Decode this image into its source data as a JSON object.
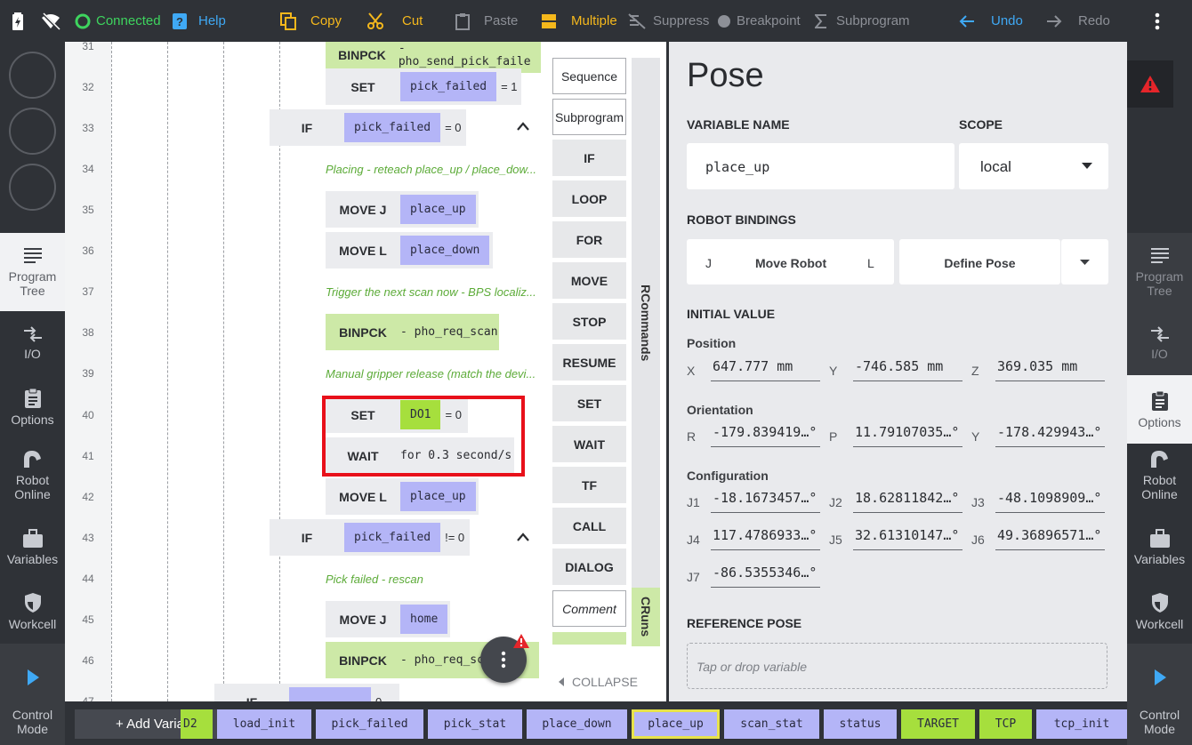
{
  "toolbar": {
    "connected": "Connected",
    "help": "Help",
    "copy": "Copy",
    "cut": "Cut",
    "paste": "Paste",
    "multiple": "Multiple",
    "suppress": "Suppress",
    "breakpoint": "Breakpoint",
    "subprogram": "Subprogram",
    "undo": "Undo",
    "redo": "Redo"
  },
  "left_nav": {
    "program_tree": "Program\nTree",
    "io": "I/O",
    "options": "Options",
    "robot_online": "Robot\nOnline",
    "variables": "Variables",
    "workcell": "Workcell",
    "control_mode": "Control\nMode"
  },
  "right_nav": {
    "program_tree": "Program\nTree",
    "io": "I/O",
    "options": "Options",
    "robot_online": "Robot\nOnline",
    "variables": "Variables",
    "workcell": "Workcell",
    "control_mode": "Control\nMode"
  },
  "program": {
    "line_numbers": [
      "31",
      "32",
      "33",
      "34",
      "35",
      "36",
      "37",
      "38",
      "39",
      "40",
      "41",
      "42",
      "43",
      "44",
      "45",
      "46",
      "47"
    ],
    "line31": {
      "kw": "BINPCK",
      "text": "- pho_send_pick_faile"
    },
    "line32": {
      "kw": "SET",
      "var": "pick_failed",
      "op": "= 1"
    },
    "line33": {
      "kw": "IF",
      "var": "pick_failed",
      "op": "= 0"
    },
    "line34": {
      "comment": "Placing - reteach place_up / place_dow..."
    },
    "line35": {
      "kw": "MOVE J",
      "var": "place_up"
    },
    "line36": {
      "kw": "MOVE L",
      "var": "place_down"
    },
    "line37": {
      "comment": "Trigger the next scan now - BPS localiz..."
    },
    "line38": {
      "kw": "BINPCK",
      "text": "- pho_req_scan"
    },
    "line39": {
      "comment": "Manual gripper release (match the devi..."
    },
    "line40": {
      "kw": "SET",
      "var": "DO1",
      "op": "= 0"
    },
    "line41": {
      "kw": "WAIT",
      "text": "for 0.3 second/s"
    },
    "line42": {
      "kw": "MOVE L",
      "var": "place_up"
    },
    "line43": {
      "kw": "IF",
      "var": "pick_failed",
      "op": "!= 0"
    },
    "line44": {
      "comment": "Pick failed - rescan"
    },
    "line45": {
      "kw": "MOVE J",
      "var": "home"
    },
    "line46": {
      "kw": "BINPCK",
      "text": "- pho_req_sc"
    },
    "line47": {
      "kw": "IF",
      "op": "0"
    }
  },
  "palette": {
    "commands": [
      "Sequence",
      "Subprogram",
      "IF",
      "LOOP",
      "FOR",
      "MOVE",
      "STOP",
      "RESUME",
      "SET",
      "WAIT",
      "TF",
      "CALL",
      "DIALOG",
      "Comment"
    ],
    "tab_rcommands": "RCommands",
    "tab_cruns": "CRuns",
    "collapse": "COLLAPSE"
  },
  "pose": {
    "title": "Pose",
    "variable_name_label": "VARIABLE NAME",
    "variable_name": "place_up",
    "scope_label": "SCOPE",
    "scope": "local",
    "robot_bindings_label": "ROBOT BINDINGS",
    "binding_j": "J",
    "move_robot": "Move Robot",
    "binding_l": "L",
    "define_pose": "Define Pose",
    "initial_value_label": "INITIAL VALUE",
    "position_label": "Position",
    "x_label": "X",
    "x": "647.777 mm",
    "y_label": "Y",
    "y": "-746.585 mm",
    "z_label": "Z",
    "z": "369.035 mm",
    "orientation_label": "Orientation",
    "r_label": "R",
    "r": "-179.839419…°",
    "p_label": "P",
    "p": "11.79107035…°",
    "oy_label": "Y",
    "oy": "-178.429943…°",
    "configuration_label": "Configuration",
    "j1_label": "J1",
    "j1": "-18.1673457…°",
    "j2_label": "J2",
    "j2": "18.62811842…°",
    "j3_label": "J3",
    "j3": "-48.1098909…°",
    "j4_label": "J4",
    "j4": "117.4786933…°",
    "j5_label": "J5",
    "j5": "32.61310147…°",
    "j6_label": "J6",
    "j6": "49.36896571…°",
    "j7_label": "J7",
    "j7": "-86.5355346…°",
    "reference_pose_label": "REFERENCE POSE",
    "reference_placeholder": "Tap or drop variable"
  },
  "variables_bar": {
    "add_variable": "+ Add Variable",
    "chips": [
      "D2",
      "load_init",
      "pick_failed",
      "pick_stat",
      "place_down",
      "place_up",
      "scan_stat",
      "status",
      "TARGET",
      "TCP",
      "tcp_init"
    ]
  },
  "colors": {
    "accent_yellow": "#f5b81c",
    "connected_green": "#3ed45e",
    "undo_blue": "#3fa9f5",
    "var_chip": "#b4b5f7",
    "io_chip": "#a6df3d",
    "binpck_block": "#cde9a7",
    "comment_green": "#5cab38",
    "highlight_red": "#e8101a",
    "alert_red": "#e5252a"
  }
}
